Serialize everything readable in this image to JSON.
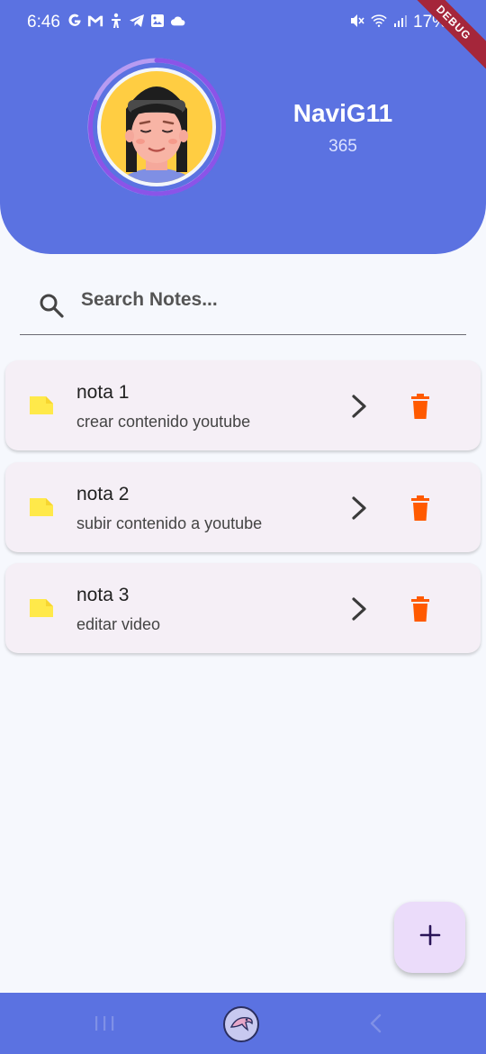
{
  "status_bar": {
    "time": "6:46",
    "battery": "17%",
    "debug_label": "DEBUG",
    "left_icons": [
      "google-icon",
      "gmail-icon",
      "accessibility-icon",
      "telegram-icon",
      "gallery-icon",
      "cloud-icon"
    ],
    "right_icons": [
      "mute-icon",
      "wifi-icon",
      "signal-icon"
    ]
  },
  "profile": {
    "username": "NaviG11",
    "score": "365"
  },
  "search": {
    "placeholder": "Search Notes..."
  },
  "notes": [
    {
      "title": "nota 1",
      "subtitle": "crear contenido youtube"
    },
    {
      "title": "nota 2",
      "subtitle": "subir contenido a youtube"
    },
    {
      "title": "nota 3",
      "subtitle": "editar video"
    }
  ],
  "fab": {
    "label": "+"
  },
  "colors": {
    "header": "#5b72e1",
    "background": "#f6f8fd",
    "card": "#f5eff6",
    "delete": "#ff5a00",
    "folder": "#ffe94a",
    "fab": "#ebdcfa",
    "avatar_ring": "#8b54e8"
  },
  "navigation": [
    "recent-apps-icon",
    "home-icon",
    "back-icon"
  ]
}
